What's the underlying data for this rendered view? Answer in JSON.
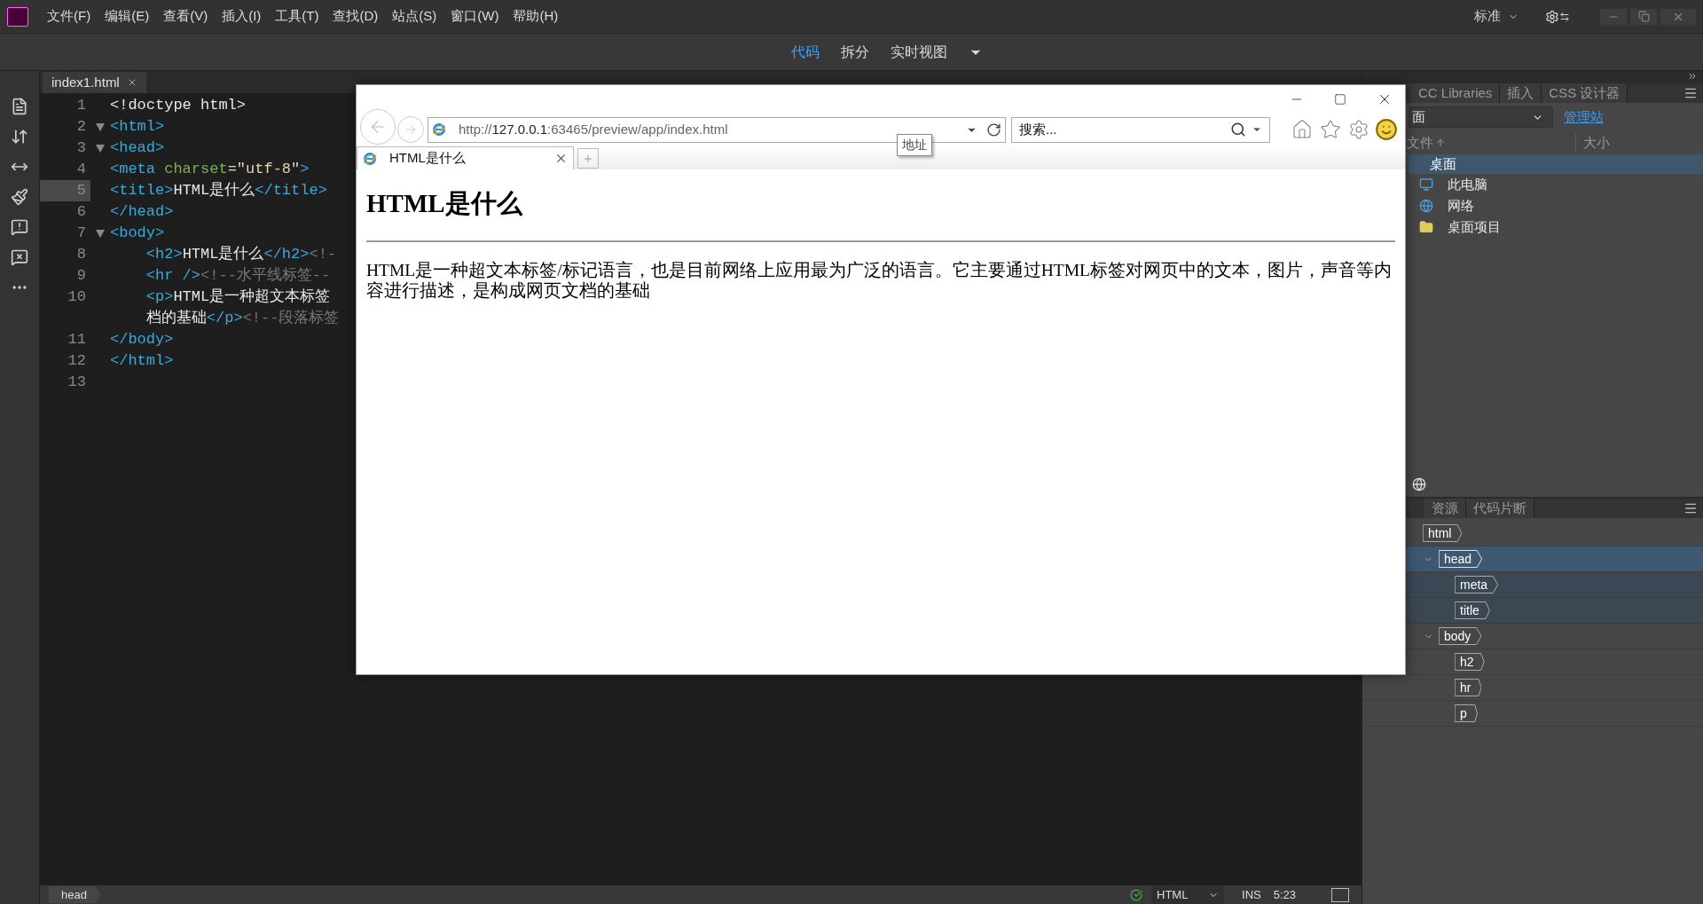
{
  "menu_bar": {
    "items": [
      "文件(F)",
      "编辑(E)",
      "查看(V)",
      "插入(I)",
      "工具(T)",
      "查找(D)",
      "站点(S)",
      "窗口(W)",
      "帮助(H)"
    ],
    "workspace": "标准"
  },
  "view_switcher": [
    {
      "label": "代码",
      "selected": true
    },
    {
      "label": "拆分",
      "selected": false
    },
    {
      "label": "实时视图",
      "selected": false
    }
  ],
  "editor": {
    "tab": "index1.html",
    "lines": [
      {
        "number": "1",
        "foldable": false,
        "current": false,
        "segments": [
          {
            "kind": "plain",
            "text": "<!doctype html>"
          }
        ]
      },
      {
        "number": "2",
        "foldable": true,
        "current": false,
        "segments": [
          {
            "kind": "tag",
            "text": "<html>"
          }
        ]
      },
      {
        "number": "3",
        "foldable": true,
        "current": false,
        "segments": [
          {
            "kind": "tag",
            "text": "<head>"
          }
        ]
      },
      {
        "number": "4",
        "foldable": false,
        "current": false,
        "segments": [
          {
            "kind": "tag",
            "text": "<meta "
          },
          {
            "kind": "attr",
            "text": "charset"
          },
          {
            "kind": "value",
            "text": "=\"utf-8\""
          },
          {
            "kind": "tag",
            "text": ">"
          }
        ]
      },
      {
        "number": "5",
        "foldable": false,
        "current": true,
        "segments": [
          {
            "kind": "tag",
            "text": "<title>"
          },
          {
            "kind": "plain",
            "text": "HTML是什么"
          },
          {
            "kind": "tag",
            "text": "</title>"
          }
        ]
      },
      {
        "number": "6",
        "foldable": false,
        "current": false,
        "segments": [
          {
            "kind": "tag",
            "text": "</head>"
          }
        ]
      },
      {
        "number": "7",
        "foldable": true,
        "current": false,
        "segments": [
          {
            "kind": "tag",
            "text": "<body>"
          }
        ]
      },
      {
        "number": "8",
        "foldable": false,
        "current": false,
        "segments": [
          {
            "kind": "tag",
            "text": "    <h2>"
          },
          {
            "kind": "plain",
            "text": "HTML是什么"
          },
          {
            "kind": "tag",
            "text": "</h2>"
          },
          {
            "kind": "comment",
            "text": "<!-"
          }
        ]
      },
      {
        "number": "9",
        "foldable": false,
        "current": false,
        "segments": [
          {
            "kind": "tag",
            "text": "    <hr />"
          },
          {
            "kind": "comment",
            "text": "<!--水平线标签--"
          }
        ]
      },
      {
        "number": "10",
        "foldable": false,
        "current": false,
        "segments": [
          {
            "kind": "tag",
            "text": "    <p>"
          },
          {
            "kind": "plain",
            "text": "HTML是一种超文本标签"
          }
        ]
      },
      {
        "foldable": false,
        "current": false,
        "segments": [
          {
            "kind": "plain",
            "text": "    档的基础"
          },
          {
            "kind": "tag",
            "text": "</p>"
          },
          {
            "kind": "comment",
            "text": "<!--段落标签"
          }
        ]
      },
      {
        "number": "11",
        "foldable": false,
        "current": false,
        "segments": [
          {
            "kind": "tag",
            "text": "</body>"
          }
        ]
      },
      {
        "number": "12",
        "foldable": false,
        "current": false,
        "segments": [
          {
            "kind": "tag",
            "text": "</html>"
          }
        ]
      },
      {
        "number": "13",
        "foldable": false,
        "current": false
      }
    ]
  },
  "status_bar": {
    "breadcrumb": "head",
    "language": "HTML",
    "mode": "INS",
    "position": "5:23"
  },
  "browser": {
    "address": {
      "scheme": "http://",
      "host": "127.0.0.1",
      "rest": ":63465/preview/app/index.html"
    },
    "search": {
      "placeholder": "搜索..."
    },
    "tooltip": "地址",
    "tab": "HTML是什么",
    "page": {
      "heading": "HTML是什么",
      "paragraph": "HTML是一种超文本标签/标记语言，也是目前网络上应用最为广泛的语言。它主要通过HTML标签对网页中的文本，图片，声音等内容进行描述，是构成网页文档的基础"
    }
  },
  "files_panel": {
    "tabs": [
      {
        "label": "CC Libraries",
        "selected": false
      },
      {
        "label": "插入",
        "selected": false
      },
      {
        "label": "CSS 设计器",
        "selected": false
      }
    ],
    "site": "面",
    "manage_link": "管理站",
    "columns": [
      "文件",
      "大小"
    ],
    "tree": [
      {
        "label": "桌面",
        "selected": true,
        "children": [
          {
            "label": "此电脑",
            "kind": "computer",
            "selected": false
          },
          {
            "label": "网络",
            "kind": "network",
            "selected": false
          },
          {
            "label": "桌面项目",
            "kind": "folder",
            "selected": false
          }
        ]
      }
    ]
  },
  "dom_panel": {
    "tabs": [
      {
        "label": "资源",
        "selected": false
      },
      {
        "label": "代码片断",
        "selected": false
      }
    ],
    "tree": [
      {
        "tag": "html",
        "selected": false,
        "children": [
          {
            "tag": "head",
            "selected": true,
            "expanded": true,
            "children": [
              {
                "tag": "meta",
                "selected": false
              },
              {
                "tag": "title",
                "selected": false
              }
            ]
          },
          {
            "tag": "body",
            "selected": false,
            "expanded": true,
            "children": [
              {
                "tag": "h2",
                "selected": false
              },
              {
                "tag": "hr",
                "selected": false
              },
              {
                "tag": "p",
                "selected": false
              }
            ]
          }
        ]
      }
    ]
  }
}
